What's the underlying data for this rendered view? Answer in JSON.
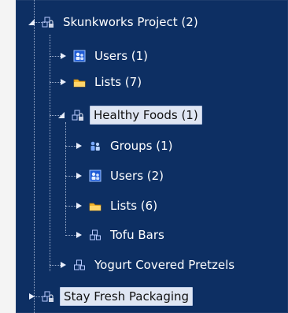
{
  "tree": {
    "nodes": [
      {
        "id": "skunkworks",
        "label": "Skunkworks Project (2)",
        "icon": "project-lock-icon",
        "expanded": true,
        "selected": false
      },
      {
        "id": "skunk-users",
        "label": "Users (1)",
        "icon": "users-icon",
        "expanded": false,
        "selected": false
      },
      {
        "id": "skunk-lists",
        "label": "Lists (7)",
        "icon": "folder-icon",
        "expanded": false,
        "selected": false
      },
      {
        "id": "healthy",
        "label": "Healthy Foods (1)",
        "icon": "project-lock-icon",
        "expanded": true,
        "selected": true
      },
      {
        "id": "healthy-groups",
        "label": "Groups (1)",
        "icon": "groups-icon",
        "expanded": false,
        "selected": false
      },
      {
        "id": "healthy-users",
        "label": "Users (2)",
        "icon": "users-icon",
        "expanded": false,
        "selected": false
      },
      {
        "id": "healthy-lists",
        "label": "Lists (6)",
        "icon": "folder-icon",
        "expanded": false,
        "selected": false
      },
      {
        "id": "tofu",
        "label": "Tofu Bars",
        "icon": "project-icon",
        "expanded": false,
        "selected": false
      },
      {
        "id": "yogurt",
        "label": "Yogurt Covered Pretzels",
        "icon": "project-icon",
        "expanded": false,
        "selected": false
      },
      {
        "id": "stayfresh",
        "label": "Stay Fresh Packaging",
        "icon": "project-lock-icon",
        "expanded": false,
        "selected": true
      }
    ]
  },
  "colors": {
    "background": "#0d2f63",
    "selection": "#dfe6f3",
    "text": "#ffffff"
  }
}
